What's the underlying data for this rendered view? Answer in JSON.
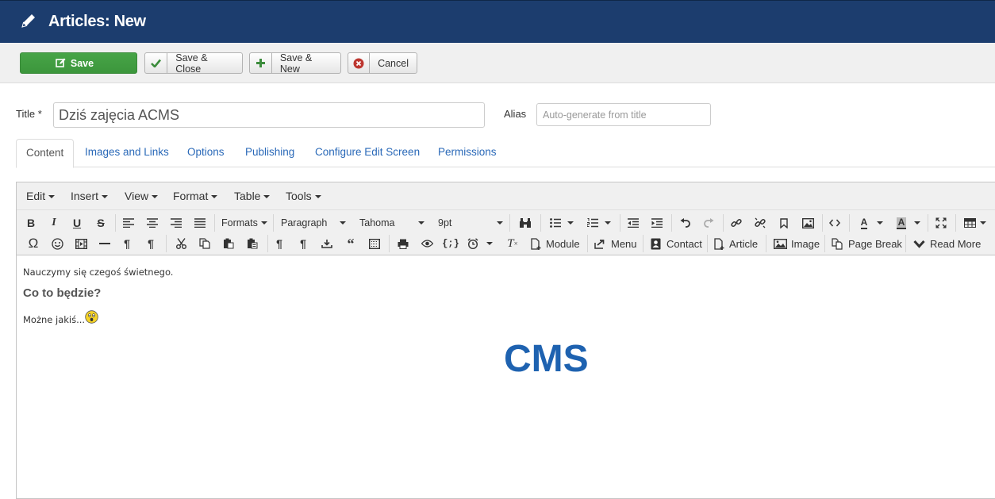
{
  "header": {
    "title": "Articles: New",
    "icon": "pencil-icon"
  },
  "toolbar": {
    "save": "Save",
    "save_close": "Save & Close",
    "save_new": "Save & New",
    "cancel": "Cancel"
  },
  "form": {
    "title_label": "Title *",
    "title_value": "Dziś zajęcia ACMS",
    "alias_label": "Alias",
    "alias_placeholder": "Auto-generate from title"
  },
  "tabs": [
    "Content",
    "Images and Links",
    "Options",
    "Publishing",
    "Configure Edit Screen",
    "Permissions"
  ],
  "editor": {
    "menus": [
      "Edit",
      "Insert",
      "View",
      "Format",
      "Table",
      "Tools"
    ],
    "formats_label": "Formats",
    "block_format": "Paragraph",
    "font_family": "Tahoma",
    "font_size": "9pt",
    "buttons": {
      "module": "Module",
      "menu": "Menu",
      "contact": "Contact",
      "article": "Article",
      "image": "Image",
      "page_break": "Page Break",
      "read_more": "Read More"
    },
    "content": {
      "line1": "Nauczymy się czegoś świetnego.",
      "heading": "Co to będzie?",
      "line2": "Możne jakiś...",
      "big_text": "CMS"
    }
  },
  "colors": {
    "header_bg": "#1c3d6e",
    "save_green": "#47a447",
    "link_blue": "#2a69b8",
    "cms_blue": "#1e62b0"
  }
}
